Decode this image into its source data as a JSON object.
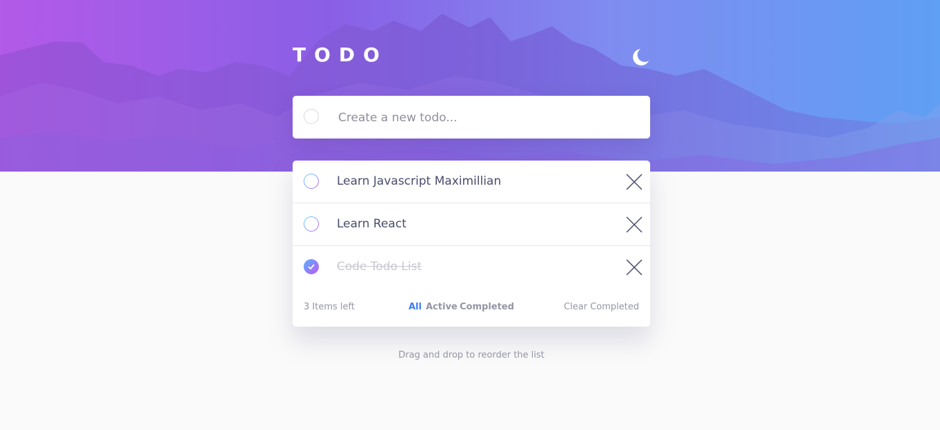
{
  "header": {
    "title": "TODO",
    "theme_icon": "moon-icon",
    "background_colors": [
      "#b35ae8",
      "#8a5fe6",
      "#7f8cf0",
      "#5f9ff4"
    ]
  },
  "new_todo": {
    "placeholder": "Create a new todo...",
    "value": ""
  },
  "todos": [
    {
      "text": "Learn Javascript Maximillian",
      "completed": false
    },
    {
      "text": "Learn React",
      "completed": false
    },
    {
      "text": "Code Todo List",
      "completed": true
    }
  ],
  "footer": {
    "items_left": "3 Items left",
    "filters": [
      "All",
      "Active",
      "Completed"
    ],
    "active_filter": "All",
    "clear_label": "Clear Completed"
  },
  "hint": "Drag and drop to reorder the list",
  "colors": {
    "accent": "#3a7bfd",
    "text": "#494c6b",
    "muted": "#9495a5",
    "check_gradient_start": "#57b4ff",
    "check_gradient_end": "#c058f3"
  }
}
